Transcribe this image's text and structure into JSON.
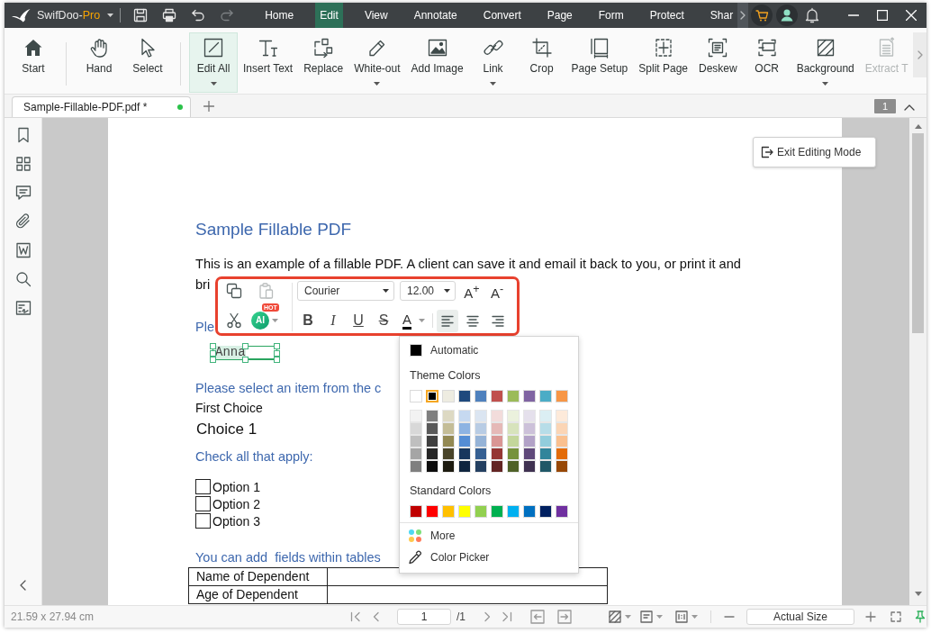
{
  "title_bar": {
    "app_name": "SwifDoo-",
    "app_edition": "Pro",
    "quick_access": [
      {
        "kind": "save",
        "disabled": false
      },
      {
        "kind": "print",
        "disabled": false
      },
      {
        "kind": "undo",
        "disabled": false
      },
      {
        "kind": "redo",
        "disabled": true
      }
    ],
    "menu_tabs": [
      {
        "label": "Home",
        "selected": false
      },
      {
        "label": "Edit",
        "selected": true
      },
      {
        "label": "View",
        "selected": false
      },
      {
        "label": "Annotate",
        "selected": false
      },
      {
        "label": "Convert",
        "selected": false
      },
      {
        "label": "Page",
        "selected": false
      },
      {
        "label": "Form",
        "selected": false
      },
      {
        "label": "Protect",
        "selected": false
      },
      {
        "label": "Shar",
        "selected": false
      }
    ]
  },
  "ribbon": {
    "groups": [
      {
        "items": [
          {
            "label": "Start",
            "selected": false,
            "has_menu": false,
            "disabled": false
          }
        ]
      },
      {
        "items": [
          {
            "label": "Hand",
            "selected": false,
            "has_menu": false,
            "disabled": false
          },
          {
            "label": "Select",
            "selected": false,
            "has_menu": false,
            "disabled": false
          }
        ]
      },
      {
        "items": [
          {
            "label": "Edit All",
            "selected": true,
            "has_menu": true,
            "disabled": false
          },
          {
            "label": "Insert Text",
            "selected": false,
            "has_menu": false,
            "disabled": false
          },
          {
            "label": "Replace",
            "selected": false,
            "has_menu": false,
            "disabled": false
          },
          {
            "label": "White-out",
            "selected": false,
            "has_menu": true,
            "disabled": false
          },
          {
            "label": "Add Image",
            "selected": false,
            "has_menu": false,
            "disabled": false
          },
          {
            "label": "Link",
            "selected": false,
            "has_menu": true,
            "disabled": false
          },
          {
            "label": "Crop",
            "selected": false,
            "has_menu": false,
            "disabled": false
          },
          {
            "label": "Page Setup",
            "selected": false,
            "has_menu": false,
            "disabled": false
          },
          {
            "label": "Split Page",
            "selected": false,
            "has_menu": false,
            "disabled": false
          },
          {
            "label": "Deskew",
            "selected": false,
            "has_menu": false,
            "disabled": false
          },
          {
            "label": "OCR",
            "selected": false,
            "has_menu": false,
            "disabled": false
          },
          {
            "label": "Background",
            "selected": false,
            "has_menu": true,
            "disabled": false
          },
          {
            "label": "Extract T",
            "selected": false,
            "has_menu": false,
            "disabled": true
          }
        ]
      }
    ]
  },
  "document_tabs": [
    {
      "title": "Sample-Fillable-PDF.pdf *",
      "selected": true
    }
  ],
  "page_badge": "1",
  "exit_editing_button": "Exit Editing Mode",
  "document": {
    "heading": "Sample Fillable PDF",
    "intro_lines": [
      "This is an example of a fillable PDF. A client can save it and email it back to you, or print it and",
      "bri"
    ],
    "name_prompt": "Ple",
    "name_field": {
      "value": "Anna",
      "editing": true
    },
    "select_prompt": "Please select an item from the c",
    "dropdown_label": "First Choice",
    "dropdown_value": "Choice 1",
    "checkbox_prompt": "Check all that apply:",
    "options": [
      {
        "label": "Option 1",
        "checked": false
      },
      {
        "label": "Option 2",
        "checked": false
      },
      {
        "label": "Option 3",
        "checked": false
      }
    ],
    "table_prompt": "You can add  fields within tables",
    "table_rows": [
      {
        "label": "Name of Dependent"
      },
      {
        "label": "Age of Dependent"
      }
    ]
  },
  "format_toolbar": {
    "clipboard": [
      {
        "kind": "copy",
        "disabled": false
      },
      {
        "kind": "paste",
        "disabled": true
      },
      {
        "kind": "cut",
        "disabled": false
      }
    ],
    "ai_label": "AI",
    "ai_badge": "HOT",
    "font": "Courier",
    "size": "12.00",
    "grow": "A$^{+}$",
    "shrink": "A$^{-}$",
    "styles": [
      {
        "kind": "bold",
        "label": "B",
        "on": false
      },
      {
        "kind": "italic",
        "label": "I",
        "on": false
      },
      {
        "kind": "underline",
        "label": "U",
        "on": false
      },
      {
        "kind": "strike",
        "label": "S",
        "on": false
      }
    ],
    "font_color_label": "A",
    "alignment": [
      {
        "kind": "left",
        "selected": true
      },
      {
        "kind": "center",
        "selected": false
      },
      {
        "kind": "right",
        "selected": false
      }
    ]
  },
  "color_menu": {
    "automatic": {
      "label": "Automatic",
      "color": "#000000"
    },
    "theme_heading": "Theme Colors",
    "theme_colors": [
      {
        "color": "#ffffff",
        "selected": false,
        "shades": [
          {
            "color": "#f2f2f2",
            "selected": false
          },
          {
            "color": "#d8d8d8",
            "selected": false
          },
          {
            "color": "#bfbfbf",
            "selected": false
          },
          {
            "color": "#a5a5a5",
            "selected": false
          },
          {
            "color": "#7f7f7f",
            "selected": false
          }
        ]
      },
      {
        "color": "#000000",
        "selected": true,
        "shades": [
          {
            "color": "#7f7f7f",
            "selected": false
          },
          {
            "color": "#595959",
            "selected": false
          },
          {
            "color": "#3f3f3f",
            "selected": false
          },
          {
            "color": "#262626",
            "selected": false
          },
          {
            "color": "#0c0c0c",
            "selected": false
          }
        ]
      },
      {
        "color": "#eeece1",
        "selected": false,
        "shades": [
          {
            "color": "#ddd9c3",
            "selected": false
          },
          {
            "color": "#c4bd97",
            "selected": false
          },
          {
            "color": "#938953",
            "selected": false
          },
          {
            "color": "#494429",
            "selected": false
          },
          {
            "color": "#1d1b10",
            "selected": false
          }
        ]
      },
      {
        "color": "#1f497d",
        "selected": false,
        "shades": [
          {
            "color": "#c6d9f0",
            "selected": false
          },
          {
            "color": "#8db3e2",
            "selected": false
          },
          {
            "color": "#548dd4",
            "selected": false
          },
          {
            "color": "#17365d",
            "selected": false
          },
          {
            "color": "#0f243e",
            "selected": false
          }
        ]
      },
      {
        "color": "#4f81bd",
        "selected": false,
        "shades": [
          {
            "color": "#dbe5f1",
            "selected": false
          },
          {
            "color": "#b8cce4",
            "selected": false
          },
          {
            "color": "#95b3d7",
            "selected": false
          },
          {
            "color": "#366092",
            "selected": false
          },
          {
            "color": "#244061",
            "selected": false
          }
        ]
      },
      {
        "color": "#c0504d",
        "selected": false,
        "shades": [
          {
            "color": "#f2dcdb",
            "selected": false
          },
          {
            "color": "#e5b9b7",
            "selected": false
          },
          {
            "color": "#d99694",
            "selected": false
          },
          {
            "color": "#953734",
            "selected": false
          },
          {
            "color": "#632423",
            "selected": false
          }
        ]
      },
      {
        "color": "#9bbb59",
        "selected": false,
        "shades": [
          {
            "color": "#ebf1dd",
            "selected": false
          },
          {
            "color": "#d7e3bc",
            "selected": false
          },
          {
            "color": "#c3d69b",
            "selected": false
          },
          {
            "color": "#76923c",
            "selected": false
          },
          {
            "color": "#4f6128",
            "selected": false
          }
        ]
      },
      {
        "color": "#8064a2",
        "selected": false,
        "shades": [
          {
            "color": "#e5e0ec",
            "selected": false
          },
          {
            "color": "#ccc1d9",
            "selected": false
          },
          {
            "color": "#b2a2c7",
            "selected": false
          },
          {
            "color": "#5f497a",
            "selected": false
          },
          {
            "color": "#3f3151",
            "selected": false
          }
        ]
      },
      {
        "color": "#4bacc6",
        "selected": false,
        "shades": [
          {
            "color": "#dbeef3",
            "selected": false
          },
          {
            "color": "#b7dde8",
            "selected": false
          },
          {
            "color": "#92cddc",
            "selected": false
          },
          {
            "color": "#31859b",
            "selected": false
          },
          {
            "color": "#205867",
            "selected": false
          }
        ]
      },
      {
        "color": "#f79646",
        "selected": false,
        "shades": [
          {
            "color": "#fdeada",
            "selected": false
          },
          {
            "color": "#fbd5b5",
            "selected": false
          },
          {
            "color": "#fac08f",
            "selected": false
          },
          {
            "color": "#e36c09",
            "selected": false
          },
          {
            "color": "#974806",
            "selected": false
          }
        ]
      }
    ],
    "standard_heading": "Standard Colors",
    "standard_colors": [
      {
        "color": "#c00000",
        "selected": false
      },
      {
        "color": "#ff0000",
        "selected": false
      },
      {
        "color": "#ffc000",
        "selected": false
      },
      {
        "color": "#ffff00",
        "selected": false
      },
      {
        "color": "#92d050",
        "selected": false
      },
      {
        "color": "#00b050",
        "selected": false
      },
      {
        "color": "#00b0f0",
        "selected": false
      },
      {
        "color": "#0070c0",
        "selected": false
      },
      {
        "color": "#002060",
        "selected": false
      },
      {
        "color": "#7030a0",
        "selected": false
      }
    ],
    "more_label": "More",
    "picker_label": "Color Picker"
  },
  "status_bar": {
    "page_size": "21.59 x 27.94 cm",
    "page_input": "1",
    "page_total": "/1",
    "zoom": "Actual Size"
  }
}
